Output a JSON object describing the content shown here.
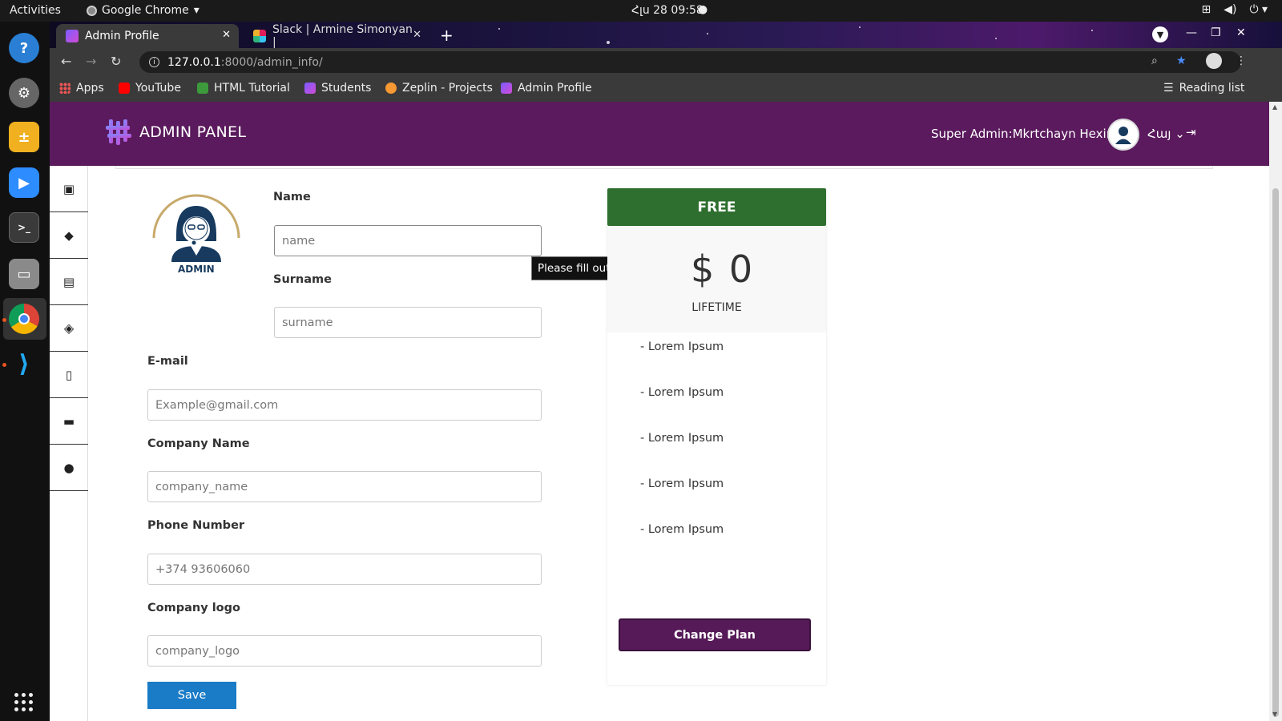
{
  "topbar": {
    "activities": "Activities",
    "app_name": "Google Chrome",
    "clock": "Հլս 28  09:58"
  },
  "tabs": [
    {
      "title": "Admin Profile"
    },
    {
      "title": "Slack | Armine Simonyan |"
    }
  ],
  "address": {
    "host": "127.0.0.1",
    "path": ":8000/admin_info/"
  },
  "bookmarks": {
    "items": [
      "Apps",
      "YouTube",
      "HTML Tutorial",
      "Students",
      "Zeplin - Projects",
      "Admin Profile"
    ],
    "reading_list": "Reading list"
  },
  "header": {
    "title": "ADMIN PANEL",
    "user": "Super Admin:Mkrtchayn Hexine",
    "language": "Հայ",
    "brand_color": "#5a1a5d"
  },
  "avatar_caption": "ADMIN",
  "form": {
    "name_label": "Name",
    "name_placeholder": "name",
    "surname_label": "Surname",
    "surname_placeholder": "surname",
    "email_label": "E-mail",
    "email_placeholder": "Example@gmail.com",
    "company_label": "Company Name",
    "company_placeholder": "company_name",
    "phone_label": "Phone Number",
    "phone_placeholder": "+374 93606060",
    "logo_label": "Company logo",
    "logo_placeholder": "company_logo",
    "save_label": "Save",
    "tooltip": "Please fill out this field."
  },
  "plan": {
    "name": "FREE",
    "price": "$ 0",
    "period": "LIFETIME",
    "features": [
      "- Lorem Ipsum",
      "- Lorem Ipsum",
      "- Lorem Ipsum",
      "- Lorem Ipsum",
      "- Lorem Ipsum"
    ],
    "change_label": "Change Plan"
  }
}
